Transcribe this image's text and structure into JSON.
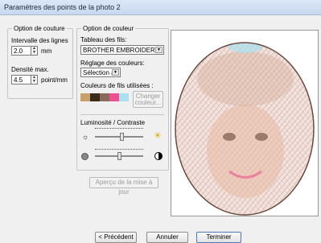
{
  "window": {
    "title": "Paramètres des points de la photo 2"
  },
  "sewing": {
    "legend": "Option de couture",
    "line_interval_label": "Intervalle des lignes",
    "line_interval_value": "2.0",
    "line_interval_unit": "mm",
    "max_density_label": "Densité max.",
    "max_density_value": "4.5",
    "max_density_unit": "point/mm"
  },
  "color": {
    "legend": "Option de couleur",
    "thread_table_label": "Tableau des fils:",
    "thread_table_value": "BROTHER EMBROIDERY",
    "color_setting_label": "Réglage des couleurs:",
    "color_setting_value": "Sélection au",
    "used_colors_label": "Couleurs de fils utilisées :",
    "swatches": [
      "#c8a06a",
      "#3a2a1e",
      "#8a6a5a",
      "#ee4f8f",
      "#a9dfef"
    ],
    "change_color_button": "Changer\ncouleur...",
    "brightness_label": "Luminosité / Contraste",
    "brightness_value": 0.55,
    "contrast_value": 0.5
  },
  "refresh_button": "Aperçu de la mise à jour",
  "footer": {
    "back_button": "< Précédent",
    "cancel_button": "Annuler",
    "finish_button": "Terminer"
  }
}
